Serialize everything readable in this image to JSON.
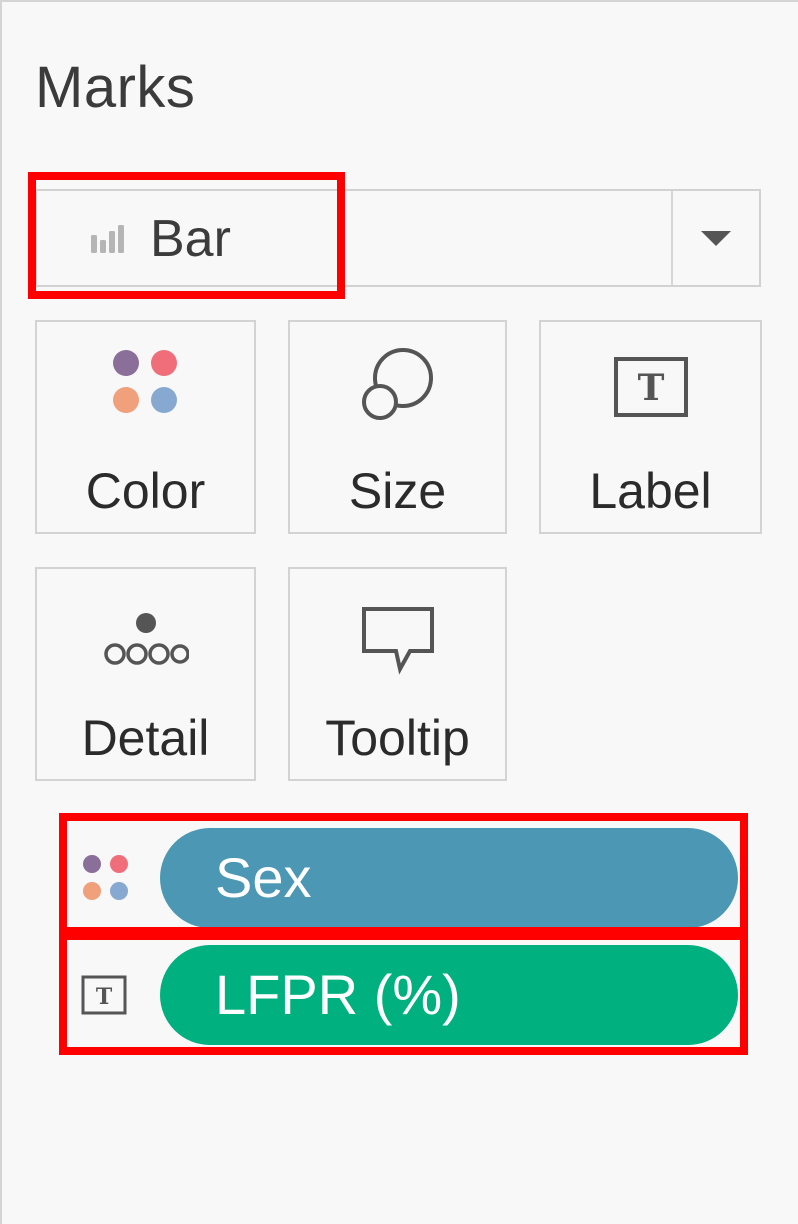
{
  "panel": {
    "title": "Marks"
  },
  "mark_type": {
    "value": "Bar",
    "icon": "bar-chart-icon"
  },
  "cards": [
    {
      "label": "Color",
      "icon": "color-dots-icon"
    },
    {
      "label": "Size",
      "icon": "size-circles-icon"
    },
    {
      "label": "Label",
      "icon": "text-label-icon"
    },
    {
      "label": "Detail",
      "icon": "detail-dots-icon"
    },
    {
      "label": "Tooltip",
      "icon": "tooltip-bubble-icon"
    }
  ],
  "fields": [
    {
      "name": "Sex",
      "encoding": "color",
      "icon": "color-dots-icon",
      "color": "#4b97b4"
    },
    {
      "name": "LFPR (%)",
      "encoding": "label",
      "icon": "text-label-icon",
      "color": "#00b07f"
    }
  ],
  "highlight_color": "#ff0000"
}
